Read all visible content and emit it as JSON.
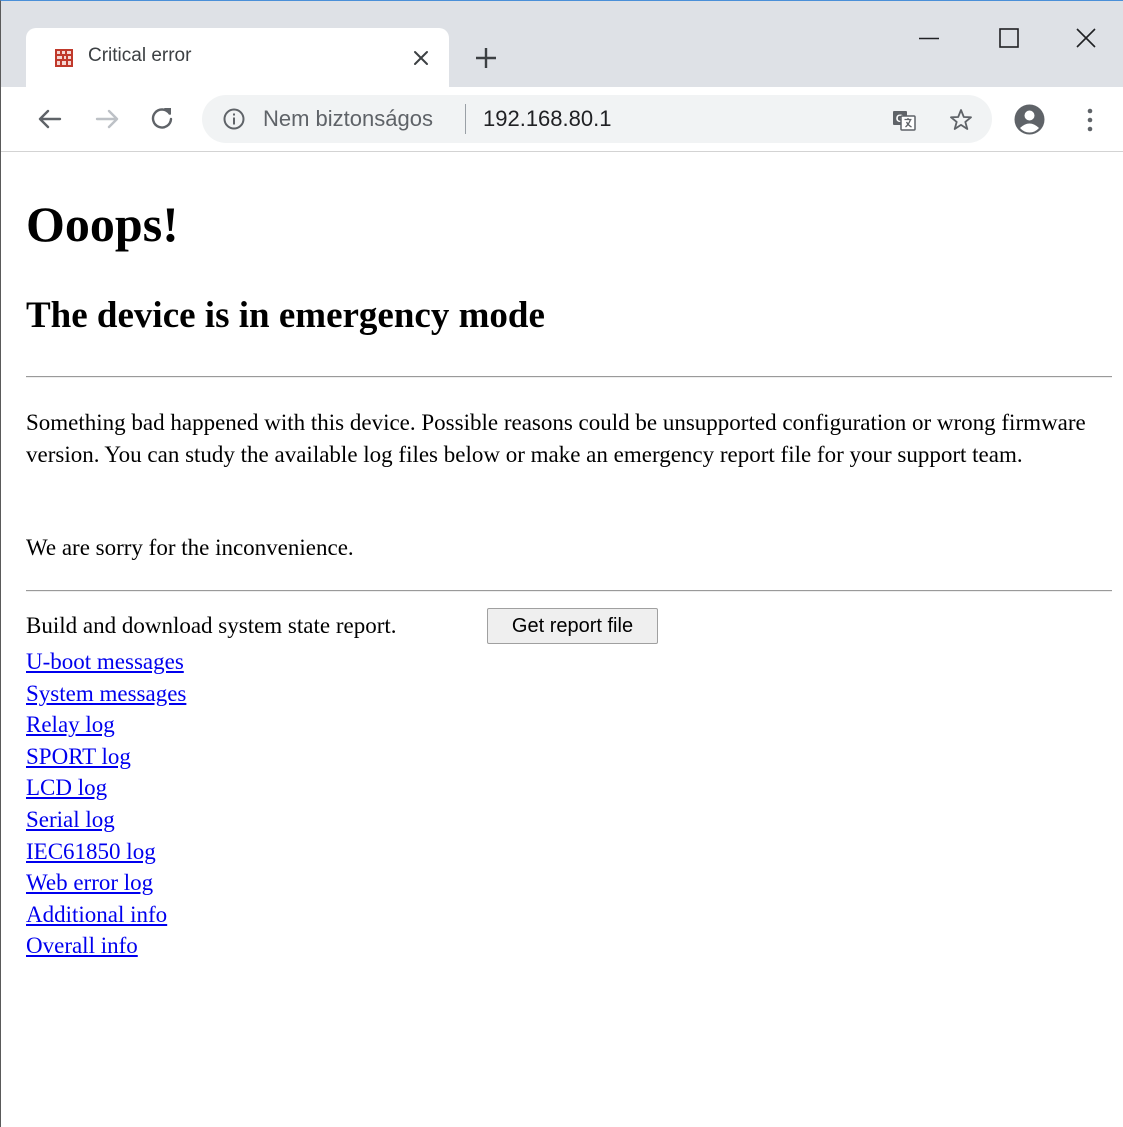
{
  "browser": {
    "tab": {
      "title": "Critical error",
      "favicon": "device-favicon-icon"
    },
    "window_controls": [
      "minimize-icon",
      "maximize-icon",
      "close-icon"
    ],
    "toolbar": {
      "security_label": "Nem biztonságos",
      "url": "192.168.80.1"
    },
    "colors": {
      "tabstrip": "#dee1e6",
      "omnibox": "#f1f3f4",
      "link": "#0000ee",
      "favicon": "#c0392b"
    }
  },
  "page": {
    "title": "Ooops!",
    "subtitle": "The device is in emergency mode",
    "description": "Something bad happened with this device. Possible reasons could be unsupported configuration or wrong firmware version. You can study the available log files below or make an emergency report file for your support team.",
    "apology": "We are sorry for the inconvenience.",
    "report": {
      "label": "Build and download system state report.",
      "button_label": "Get report file"
    },
    "links": [
      "U-boot messages",
      "System messages",
      "Relay log",
      "SPORT log",
      "LCD log",
      "Serial log",
      "IEC61850 log",
      "Web error log",
      "Additional info",
      "Overall info"
    ]
  }
}
